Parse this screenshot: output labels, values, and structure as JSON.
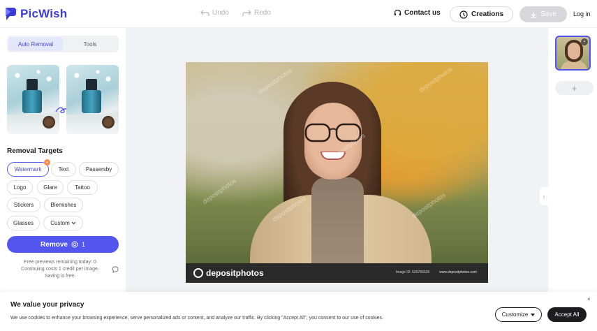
{
  "header": {
    "brand": "PicWish",
    "undo_label": "Undo",
    "redo_label": "Redo",
    "contact_label": "Contact us",
    "creations_label": "Creations",
    "save_label": "Save",
    "login_label": "Log in",
    "brand_color": "#3c3cd8"
  },
  "left_panel": {
    "tabs": [
      {
        "label": "Auto Removal",
        "active": true
      },
      {
        "label": "Tools",
        "active": false
      }
    ],
    "section_title": "Removal Targets",
    "targets": [
      {
        "label": "Watermark",
        "active": true
      },
      {
        "label": "Text",
        "active": false
      },
      {
        "label": "Passersby",
        "active": false
      },
      {
        "label": "Logo",
        "active": false
      },
      {
        "label": "Glare",
        "active": false
      },
      {
        "label": "Tattoo",
        "active": false
      },
      {
        "label": "Stickers",
        "active": false
      },
      {
        "label": "Blemishes",
        "active": false
      },
      {
        "label": "Glasses",
        "active": false
      },
      {
        "label": "Custom",
        "active": false
      }
    ],
    "remove_label": "Remove",
    "remove_cost": "1",
    "notes": [
      "Free previews remaining today: 0",
      "Continuing costs 1 credit per image.",
      "Saving is free."
    ],
    "accent_color": "#5356ee"
  },
  "canvas": {
    "photo_watermark": "depositphotos",
    "brand_bar_logo": "depositphotos",
    "image_id": "Image ID: 625789328",
    "site": "www.depositphotos.com"
  },
  "right_panel": {
    "add_label": "+"
  },
  "cookie_banner": {
    "title": "We value your privacy",
    "text": "We use cookies to enhance your browsing experience, serve personalized ads or content, and analyze our traffic. By clicking \"Accept All\", you consent to our use of cookies.",
    "customize_label": "Customize",
    "accept_label": "Accept All",
    "close_label": "×"
  }
}
